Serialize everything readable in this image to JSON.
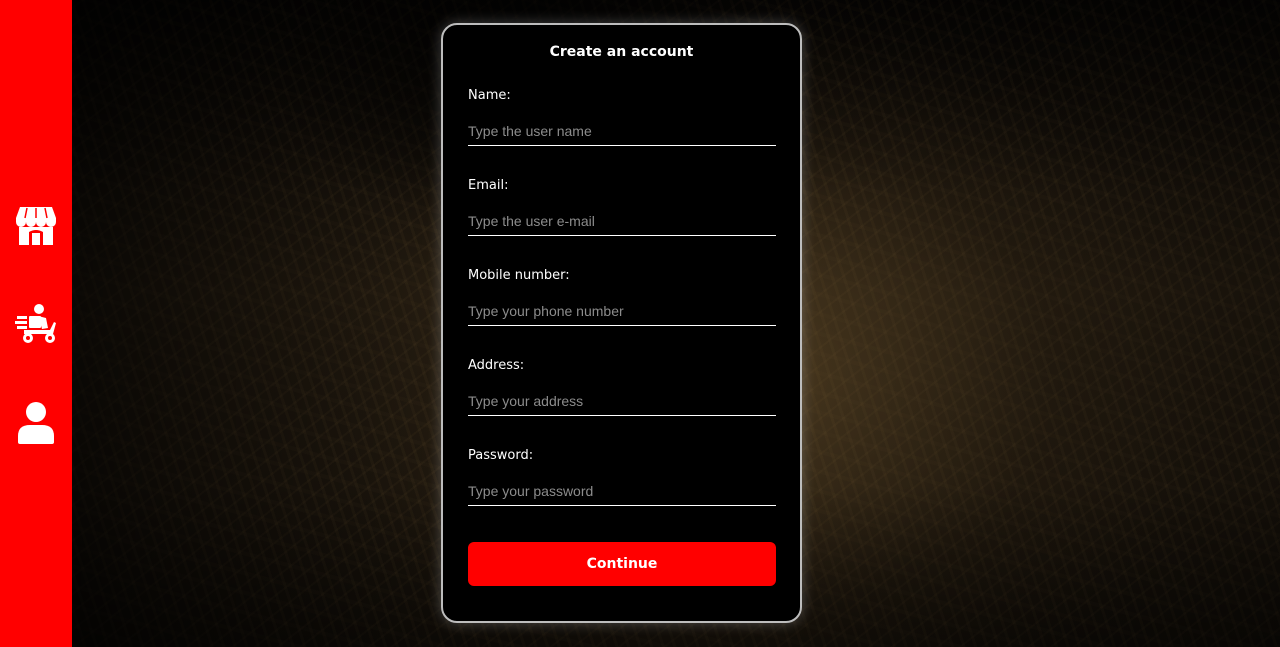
{
  "sidebar": {
    "items": [
      {
        "icon": "store-icon"
      },
      {
        "icon": "delivery-scooter-icon"
      },
      {
        "icon": "user-icon"
      }
    ],
    "color": "#ff0000"
  },
  "form": {
    "title": "Create an account",
    "fields": [
      {
        "label": "Name:",
        "placeholder": "Type the user name",
        "value": ""
      },
      {
        "label": "Email:",
        "placeholder": "Type the user e-mail",
        "value": ""
      },
      {
        "label": "Mobile number:",
        "placeholder": "Type your phone number",
        "value": ""
      },
      {
        "label": "Address:",
        "placeholder": "Type your address",
        "value": ""
      },
      {
        "label": "Password:",
        "placeholder": "Type your password",
        "value": ""
      }
    ],
    "submit_label": "Continue",
    "accent_color": "#ff0000"
  }
}
